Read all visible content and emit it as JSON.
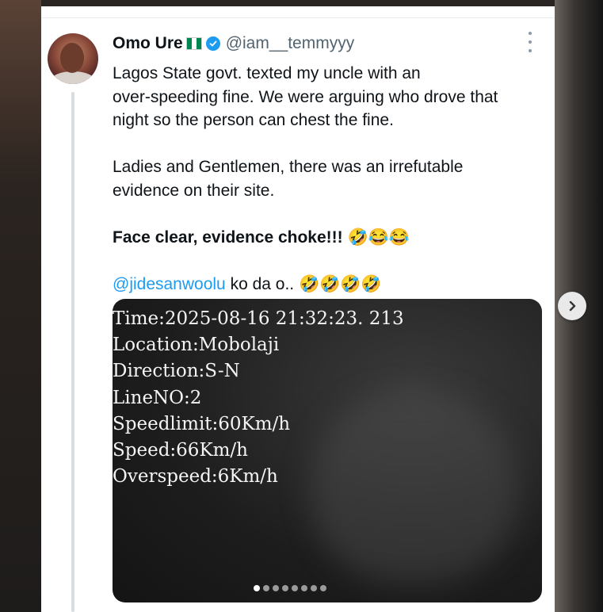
{
  "tweet": {
    "author_name": "Omo Ure",
    "author_flag": "nigeria-flag-icon",
    "verified": true,
    "handle": "@iam__temmyyy",
    "line1": "Lagos State govt. texted my uncle with an",
    "line2": "over-speeding fine. We were arguing who drove that",
    "line3": "night so the person can chest the fine.",
    "line4": "Ladies and Gentlemen, there was an irrefutable",
    "line5": "evidence on their site.",
    "line6": "Face clear, evidence choke!!! 🤣😂😂",
    "mention": "@jidesanwoolu",
    "line7_rest": " ko da o.. 🤣🤣🤣🤣"
  },
  "media": {
    "overlay": [
      "Time:2025-08-16 21:32:23. 213",
      "Location:Mobolaji",
      "Direction:S-N",
      "LineNO:2",
      "Speedlimit:60Km/h",
      "Speed:66Km/h",
      "Overspeed:6Km/h"
    ],
    "total_images": 8,
    "active_index": 0
  },
  "colors": {
    "accent": "#1d9bf0",
    "text": "#0f1419",
    "muted": "#536471",
    "flag_green": "#008751",
    "flag_white": "#ffffff"
  },
  "icons": {
    "more": "more-vertical-icon",
    "next": "chevron-right-icon",
    "verified": "verified-badge-icon"
  }
}
